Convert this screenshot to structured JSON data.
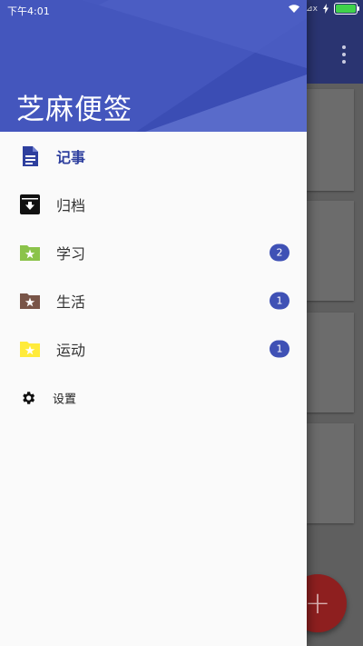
{
  "status_bar": {
    "time": "下午4:01",
    "signal_label": "⊿x",
    "battery_level": 0.9
  },
  "drawer": {
    "title": "芝麻便签",
    "items": [
      {
        "label": "记事",
        "icon": "note-icon",
        "active": true
      },
      {
        "label": "归档",
        "icon": "archive-icon"
      },
      {
        "label": "学习",
        "icon": "folder-star-icon",
        "color": "#8bc34a",
        "badge": "2"
      },
      {
        "label": "生活",
        "icon": "folder-star-icon",
        "color": "#795548",
        "badge": "1"
      },
      {
        "label": "运动",
        "icon": "folder-star-icon",
        "color": "#ffeb3b",
        "badge": "1"
      }
    ],
    "settings_label": "设置"
  },
  "fab": {
    "label": "+"
  },
  "colors": {
    "primary": "#3f51b5",
    "primary_dark": "#2e3f9e",
    "fab": "#8e1f1f"
  }
}
